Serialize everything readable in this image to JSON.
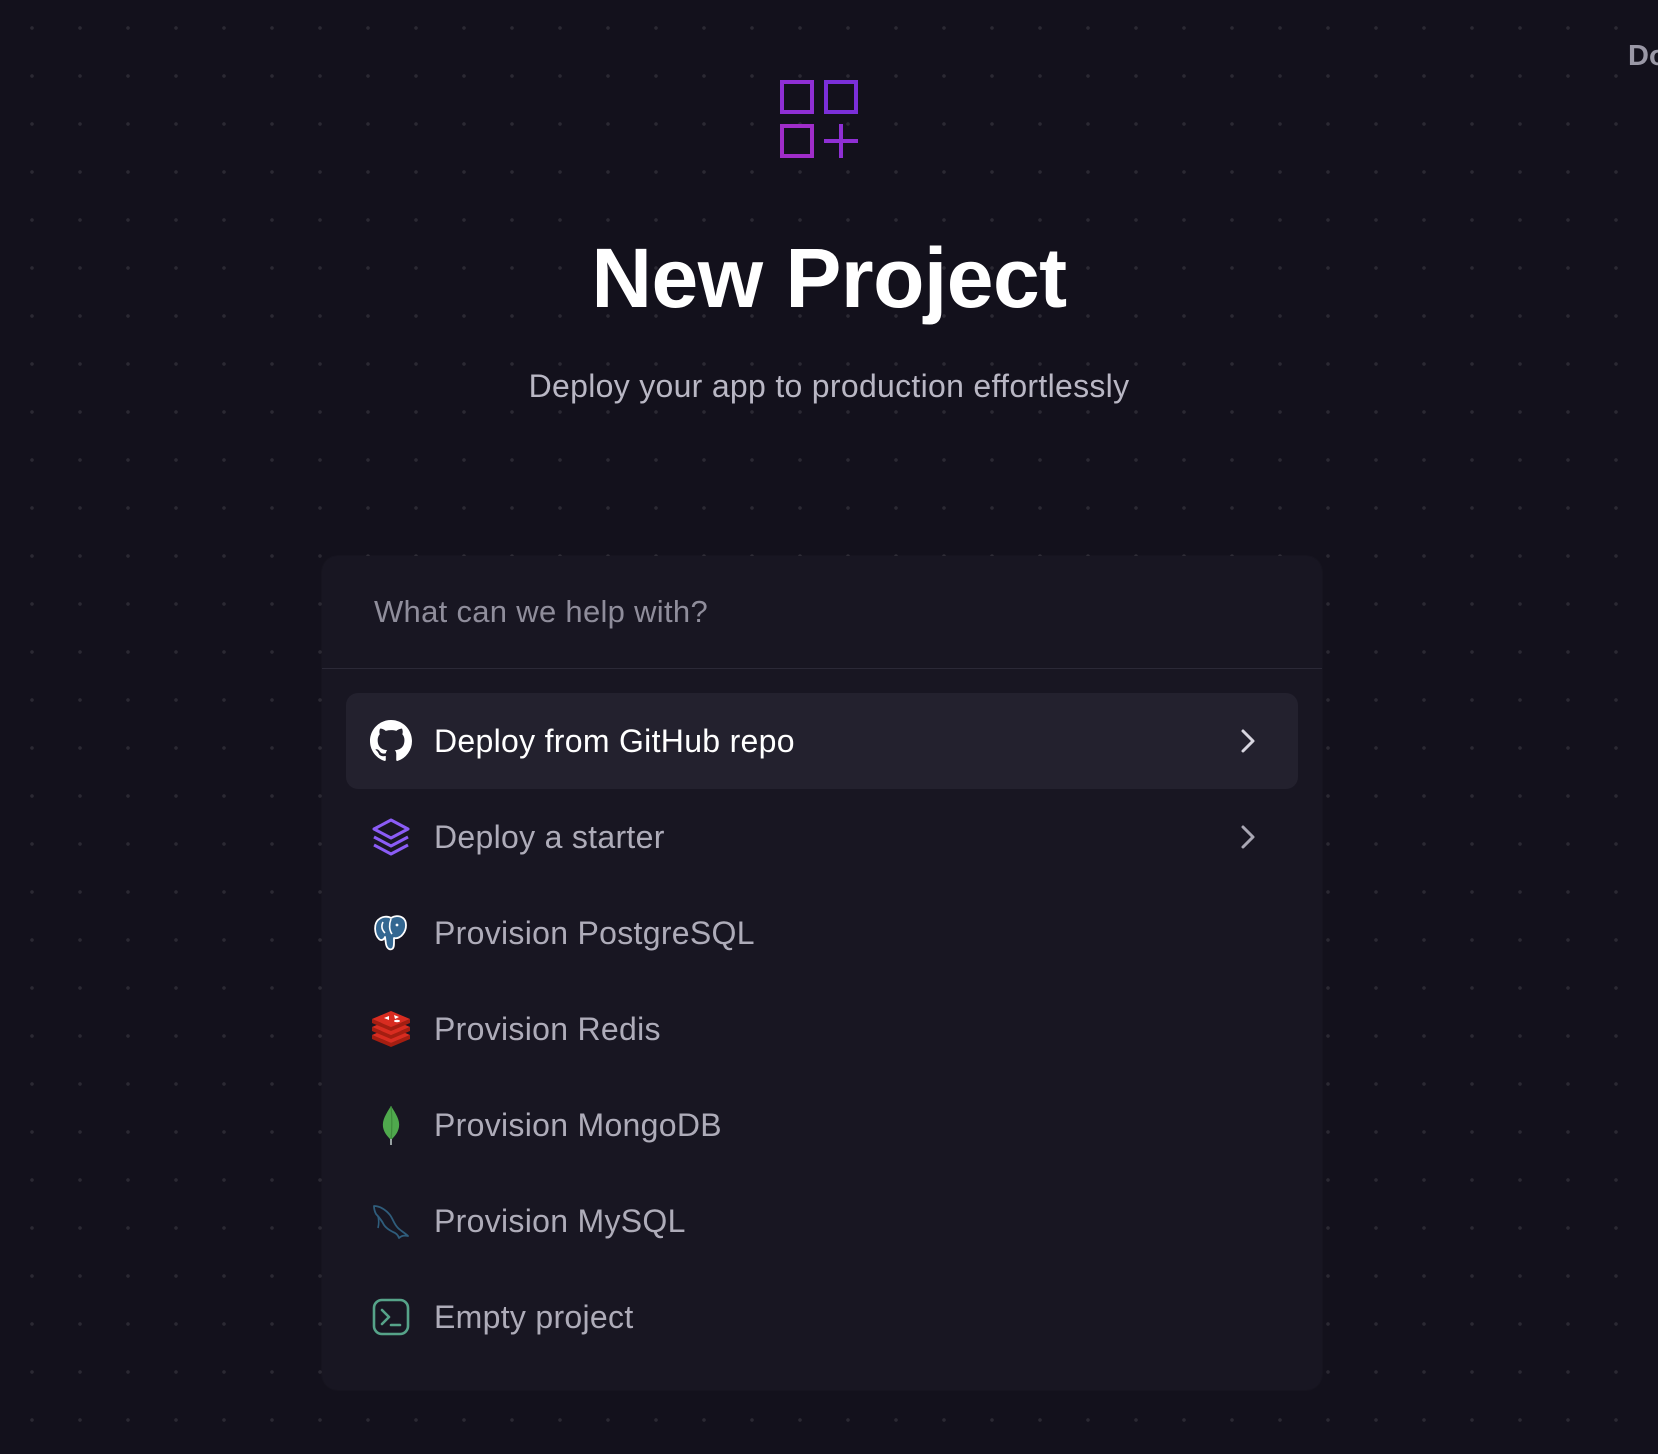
{
  "corner_link": {
    "label": "Do"
  },
  "logo": {
    "icon": "apps-plus-icon",
    "color": "#8f2fd4"
  },
  "header": {
    "title": "New Project",
    "subtitle": "Deploy your app to production effortlessly"
  },
  "search": {
    "placeholder": "What can we help with?",
    "value": ""
  },
  "options": [
    {
      "label": "Deploy from GitHub repo",
      "icon": "github-icon",
      "has_submenu": true,
      "active": true
    },
    {
      "label": "Deploy a starter",
      "icon": "layers-icon",
      "has_submenu": true,
      "active": false
    },
    {
      "label": "Provision PostgreSQL",
      "icon": "postgresql-icon",
      "has_submenu": false,
      "active": false
    },
    {
      "label": "Provision Redis",
      "icon": "redis-icon",
      "has_submenu": false,
      "active": false
    },
    {
      "label": "Provision MongoDB",
      "icon": "mongodb-icon",
      "has_submenu": false,
      "active": false
    },
    {
      "label": "Provision MySQL",
      "icon": "mysql-icon",
      "has_submenu": false,
      "active": false
    },
    {
      "label": "Empty project",
      "icon": "terminal-icon",
      "has_submenu": false,
      "active": false
    }
  ],
  "colors": {
    "background": "#13111c",
    "card": "#181622",
    "active_row": "#23212e",
    "accent_purple": "#8f2fd4",
    "starter_purple": "#8b5cf6",
    "redis_red": "#c6302b",
    "mongodb_green": "#4fa94d",
    "terminal_green": "#56a389"
  }
}
